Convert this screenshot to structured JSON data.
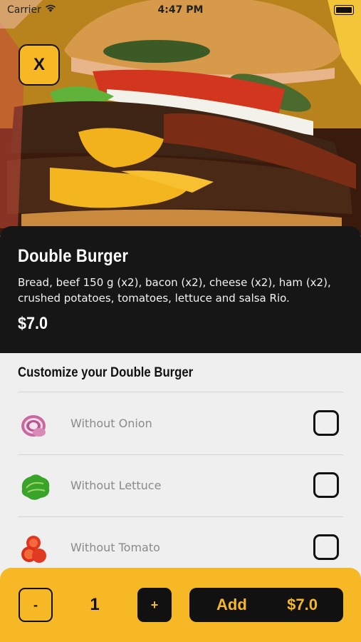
{
  "status_bar": {
    "carrier": "Carrier",
    "time": "4:47 PM"
  },
  "header": {
    "close_label": "X"
  },
  "product": {
    "name": "Double Burger",
    "description": "Bread, beef 150 g (x2), bacon (x2), cheese (x2), ham (x2), crushed potatoes, tomatoes, lettuce and salsa Rio.",
    "price": "$7.0"
  },
  "customize": {
    "title": "Customize your Double Burger",
    "options": [
      {
        "label": "Without Onion",
        "icon": "onion-icon",
        "checked": false
      },
      {
        "label": "Without Lettuce",
        "icon": "lettuce-icon",
        "checked": false
      },
      {
        "label": "Without Tomato",
        "icon": "tomato-icon",
        "checked": false
      }
    ]
  },
  "order": {
    "minus_label": "-",
    "plus_label": "+",
    "quantity": "1",
    "add_label": "Add",
    "total": "$7.0"
  },
  "colors": {
    "accent": "#f6b824",
    "dark": "#161616",
    "background": "#efefef"
  }
}
